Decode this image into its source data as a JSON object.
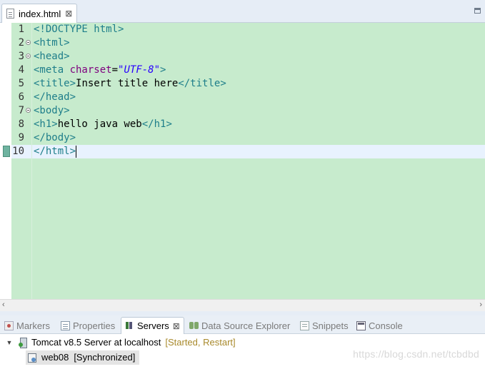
{
  "editor": {
    "tab": {
      "label": "index.html",
      "close": "⊠"
    },
    "lines": [
      {
        "num": "1",
        "fold": false,
        "parts": [
          {
            "t": "tag",
            "s": "<!DOCTYPE html>"
          }
        ]
      },
      {
        "num": "2",
        "fold": true,
        "parts": [
          {
            "t": "tag",
            "s": "<html>"
          }
        ]
      },
      {
        "num": "3",
        "fold": true,
        "parts": [
          {
            "t": "tag",
            "s": "<head>"
          }
        ]
      },
      {
        "num": "4",
        "fold": false,
        "parts": [
          {
            "t": "tag",
            "s": "<meta "
          },
          {
            "t": "attr",
            "s": "charset"
          },
          {
            "t": "txt",
            "s": "="
          },
          {
            "t": "val",
            "s": "\"UTF-8\""
          },
          {
            "t": "tag",
            "s": ">"
          }
        ]
      },
      {
        "num": "5",
        "fold": false,
        "parts": [
          {
            "t": "tag",
            "s": "<title>"
          },
          {
            "t": "txt",
            "s": "Insert title here"
          },
          {
            "t": "tag",
            "s": "</title>"
          }
        ]
      },
      {
        "num": "6",
        "fold": false,
        "parts": [
          {
            "t": "tag",
            "s": "</head>"
          }
        ]
      },
      {
        "num": "7",
        "fold": true,
        "parts": [
          {
            "t": "tag",
            "s": "<body>"
          }
        ]
      },
      {
        "num": "8",
        "fold": false,
        "parts": [
          {
            "t": "tag",
            "s": "<h1>"
          },
          {
            "t": "txt",
            "s": "hello java web"
          },
          {
            "t": "tag",
            "s": "</h1>"
          }
        ]
      },
      {
        "num": "9",
        "fold": false,
        "parts": [
          {
            "t": "tag",
            "s": "</body>"
          }
        ]
      },
      {
        "num": "10",
        "fold": false,
        "parts": [
          {
            "t": "tag",
            "s": "</html>"
          }
        ],
        "current": true
      }
    ],
    "colors": {
      "background": "#c7ebcd",
      "current_line": "#e8f2fe",
      "tag": "#1e7e8a",
      "attribute": "#7f007f",
      "value": "#2a00ff"
    }
  },
  "scrollbar": {
    "left_arrow": "‹",
    "right_arrow": "›"
  },
  "panel": {
    "tabs": [
      {
        "id": "markers",
        "label": "Markers",
        "icon": "markers-icon"
      },
      {
        "id": "properties",
        "label": "Properties",
        "icon": "properties-icon"
      },
      {
        "id": "servers",
        "label": "Servers",
        "icon": "servers-icon",
        "active": true
      },
      {
        "id": "data-source",
        "label": "Data Source Explorer",
        "icon": "data-source-icon"
      },
      {
        "id": "snippets",
        "label": "Snippets",
        "icon": "snippets-icon"
      },
      {
        "id": "console",
        "label": "Console",
        "icon": "console-icon"
      }
    ],
    "servers_close": "⊠",
    "server": {
      "name": "Tomcat v8.5 Server at localhost",
      "status": "[Started, Restart]",
      "twisty": "▼"
    },
    "module": {
      "name": "web08",
      "state": "[Synchronized]"
    }
  },
  "watermark": "https://blog.csdn.net/tcbdbd"
}
